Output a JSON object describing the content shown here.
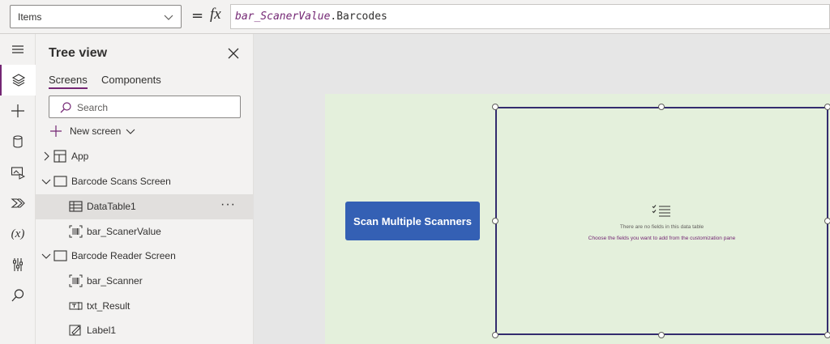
{
  "formula_bar": {
    "property": "Items",
    "equals": "=",
    "fx": "fx",
    "formula_var": "bar_ScanerValue",
    "formula_rest": ".Barcodes"
  },
  "rail": {
    "items": [
      "menu-icon",
      "layers-icon",
      "insert-icon",
      "data-icon",
      "media-icon",
      "power-automate-icon",
      "variables-icon",
      "advanced-tools-icon",
      "search-icon"
    ],
    "variables_label": "(x)"
  },
  "tree_view": {
    "title": "Tree view",
    "tabs": [
      "Screens",
      "Components"
    ],
    "search_placeholder": "Search",
    "new_screen_label": "New screen",
    "nodes": [
      {
        "label": "App",
        "icon": "app-icon"
      },
      {
        "label": "Barcode Scans Screen",
        "icon": "screen-icon"
      },
      {
        "label": "DataTable1",
        "icon": "datatable-icon",
        "selected": true,
        "more": "···"
      },
      {
        "label": "bar_ScanerValue",
        "icon": "barcode-icon"
      },
      {
        "label": "Barcode Reader Screen",
        "icon": "screen-icon"
      },
      {
        "label": "bar_Scanner",
        "icon": "barcode-icon"
      },
      {
        "label": "txt_Result",
        "icon": "text-input-icon"
      },
      {
        "label": "Label1",
        "icon": "label-icon"
      }
    ]
  },
  "canvas": {
    "button_label": "Scan Multiple Scanners",
    "datatable_empty_line1": "There are no fields in this data table",
    "datatable_empty_line2": "Choose the fields you want to add from the customization pane"
  },
  "colors": {
    "accent": "#742774",
    "button": "#3460b4",
    "screen_bg": "#e4f0dc",
    "selection_border": "#332c6e"
  }
}
